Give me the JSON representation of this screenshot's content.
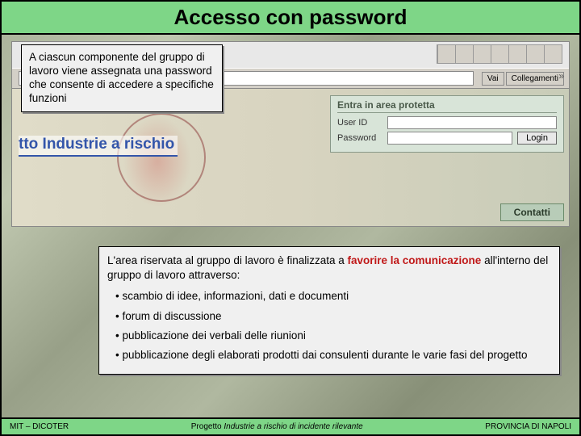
{
  "title": "Accesso con password",
  "info1": "A ciascun componente del gruppo di lavoro viene assegnata una password che consente di accedere a specifiche funzioni",
  "browser": {
    "go": "Vai",
    "links": "Collegamenti",
    "site_title": "tto Industrie a rischio"
  },
  "login": {
    "header": "Entra in area protetta",
    "user_label": "User ID",
    "pass_label": "Password",
    "button": "Login"
  },
  "contatti": "Contatti",
  "info2": {
    "lead_a": "L'area riservata al gruppo di lavoro è finalizzata a ",
    "lead_b": "favorire la comunicazione",
    "lead_c": " all'interno del gruppo di lavoro attraverso:",
    "bullets": [
      "scambio di idee, informazioni, dati e documenti",
      "forum di discussione",
      "pubblicazione dei verbali delle riunioni",
      "pubblicazione degli elaborati prodotti dai consulenti durante le varie fasi del progetto"
    ]
  },
  "footer": {
    "left": "MIT – DICOTER",
    "center_label": "Progetto",
    "center_italic": "Industrie a rischio di incidente rilevante",
    "right": "PROVINCIA DI NAPOLI"
  }
}
